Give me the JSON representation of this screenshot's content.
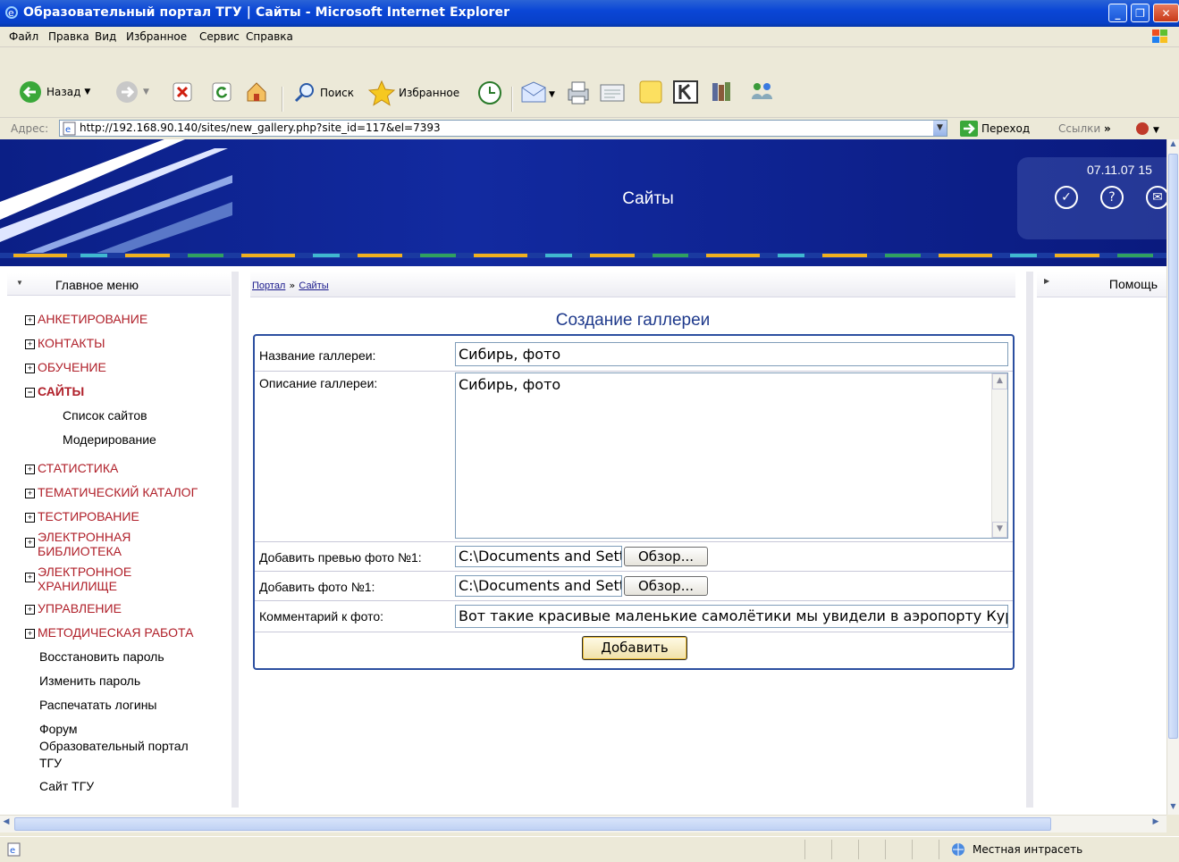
{
  "window": {
    "title": "Образовательный портал ТГУ | Сайты - Microsoft Internet Explorer",
    "min_glyph": "_",
    "max_glyph": "❐",
    "close_glyph": "✕"
  },
  "menubar": {
    "items": [
      "Файл",
      "Правка",
      "Вид",
      "Избранное",
      "Сервис",
      "Справка"
    ]
  },
  "toolbar": {
    "back_label": "Назад",
    "search_label": "Поиск",
    "favorites_label": "Избранное"
  },
  "addressbar": {
    "label": "Адрес:",
    "url": "http://192.168.90.140/sites/new_gallery.php?site_id=117&el=7393",
    "go_label": "Переход",
    "links_label": "Ссылки"
  },
  "header": {
    "title": "Сайты",
    "date": "07.11.07 15"
  },
  "left_menu": {
    "title": "Главное меню",
    "sections": [
      {
        "label": "АНКЕТИРОВАНИЕ",
        "state": "+"
      },
      {
        "label": "КОНТАКТЫ",
        "state": "+"
      },
      {
        "label": "ОБУЧЕНИЕ",
        "state": "+"
      },
      {
        "label": "САЙТЫ",
        "state": "−"
      },
      {
        "label": "СТАТИСТИКА",
        "state": "+"
      },
      {
        "label": "ТЕМАТИЧЕСКИЙ КАТАЛОГ",
        "state": "+"
      },
      {
        "label": "ТЕСТИРОВАНИЕ",
        "state": "+"
      },
      {
        "label": "ЭЛЕКТРОННАЯ",
        "label2": "БИБЛИОТЕКА",
        "state": "+"
      },
      {
        "label": "ЭЛЕКТРОННОЕ",
        "label2": "ХРАНИЛИЩЕ",
        "state": "+"
      },
      {
        "label": "УПРАВЛЕНИЕ",
        "state": "+"
      },
      {
        "label": "МЕТОДИЧЕСКАЯ РАБОТА",
        "state": "+"
      }
    ],
    "site_subitems": [
      "Список сайтов",
      "Модерирование"
    ],
    "links": [
      "Восстановить пароль",
      "Изменить пароль",
      "Распечатать логины",
      "Форум",
      "Образовательный портал",
      "ТГУ",
      "Сайт ТГУ"
    ]
  },
  "breadcrumb": {
    "portal": "Портал",
    "sep": "»",
    "current": "Сайты"
  },
  "form": {
    "title": "Создание галлереи",
    "name_label": "Название галлереи:",
    "name_value": "Сибирь, фото",
    "desc_label": "Описание галлереи:",
    "desc_value": "Сибирь, фото",
    "preview_label": "Добавить превью фото №1:",
    "preview_value": "C:\\Documents and Setti",
    "photo_label": "Добавить фото №1:",
    "photo_value": "C:\\Documents and Setti",
    "browse_label": "Обзор...",
    "comment_label": "Комментарий к фото:",
    "comment_value": "Вот такие красивые маленькие самолётики мы увидели в аэропорту Кур",
    "submit_label": "Добавить"
  },
  "right_panel": {
    "title": "Помощь"
  },
  "statusbar": {
    "zone": "Местная интрасеть"
  }
}
